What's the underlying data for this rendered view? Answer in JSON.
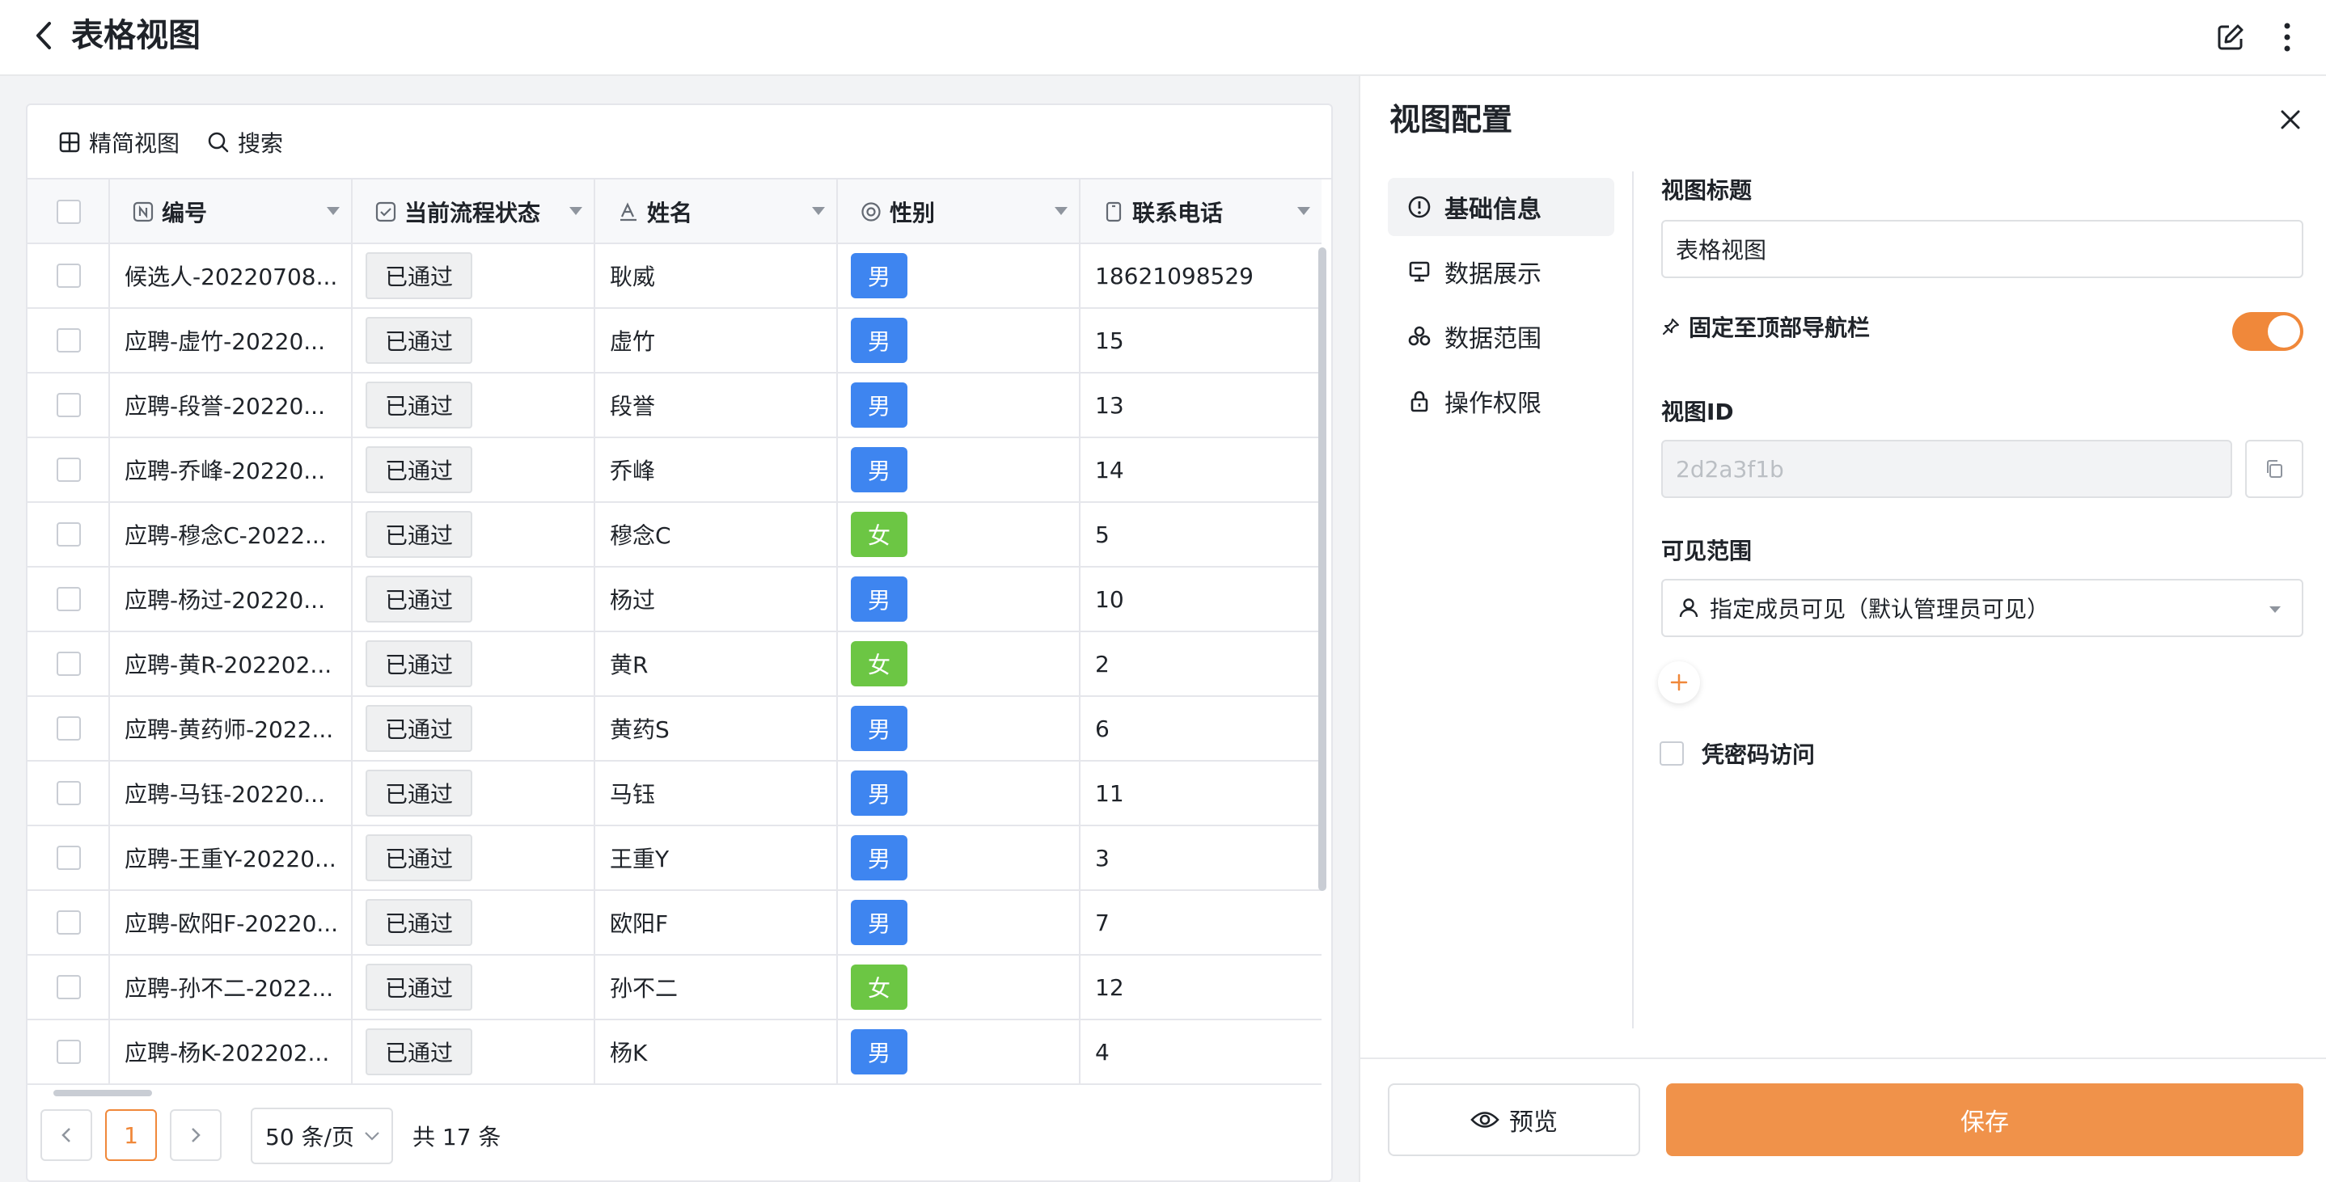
{
  "header": {
    "title": "表格视图",
    "back_icon": "chevron-left-icon",
    "edit_icon": "edit-icon",
    "more_icon": "more-vertical-icon"
  },
  "toolbar": {
    "compact_view": "精简视图",
    "search": "搜索"
  },
  "table": {
    "columns": [
      "编号",
      "当前流程状态",
      "姓名",
      "性别",
      "联系电话"
    ],
    "rows": [
      {
        "id": "候选人-20220708...",
        "status": "已通过",
        "name": "耿威",
        "gender": "男",
        "phone": "18621098529"
      },
      {
        "id": "应聘-虚竹-20220...",
        "status": "已通过",
        "name": "虚竹",
        "gender": "男",
        "phone": "15"
      },
      {
        "id": "应聘-段誉-20220...",
        "status": "已通过",
        "name": "段誉",
        "gender": "男",
        "phone": "13"
      },
      {
        "id": "应聘-乔峰-20220...",
        "status": "已通过",
        "name": "乔峰",
        "gender": "男",
        "phone": "14"
      },
      {
        "id": "应聘-穆念C-2022...",
        "status": "已通过",
        "name": "穆念C",
        "gender": "女",
        "phone": "5"
      },
      {
        "id": "应聘-杨过-20220...",
        "status": "已通过",
        "name": "杨过",
        "gender": "男",
        "phone": "10"
      },
      {
        "id": "应聘-黄R-202202...",
        "status": "已通过",
        "name": "黄R",
        "gender": "女",
        "phone": "2"
      },
      {
        "id": "应聘-黄药师-2022...",
        "status": "已通过",
        "name": "黄药S",
        "gender": "男",
        "phone": "6"
      },
      {
        "id": "应聘-马钰-20220...",
        "status": "已通过",
        "name": "马钰",
        "gender": "男",
        "phone": "11"
      },
      {
        "id": "应聘-王重Y-20220...",
        "status": "已通过",
        "name": "王重Y",
        "gender": "男",
        "phone": "3"
      },
      {
        "id": "应聘-欧阳F-20220...",
        "status": "已通过",
        "name": "欧阳F",
        "gender": "男",
        "phone": "7"
      },
      {
        "id": "应聘-孙不二-2022...",
        "status": "已通过",
        "name": "孙不二",
        "gender": "女",
        "phone": "12"
      },
      {
        "id": "应聘-杨K-202202...",
        "status": "已通过",
        "name": "杨K",
        "gender": "男",
        "phone": "4"
      }
    ]
  },
  "pagination": {
    "current_page": "1",
    "page_size": "50 条/页",
    "total": "共 17 条"
  },
  "panel": {
    "title": "视图配置",
    "nav": [
      "基础信息",
      "数据展示",
      "数据范围",
      "操作权限"
    ],
    "active_nav": "基础信息",
    "view_title_label": "视图标题",
    "view_title_value": "表格视图",
    "pin_label": "固定至顶部导航栏",
    "pin_enabled": true,
    "view_id_label": "视图ID",
    "view_id_value": "2d2a3f1b",
    "visibility_label": "可见范围",
    "visibility_value": "指定成员可见（默认管理员可见）",
    "password_label": "凭密码访问",
    "preview_button": "预览",
    "save_button": "保存"
  },
  "colors": {
    "accent": "#f0883a",
    "male": "#3e85f0",
    "female": "#6cc644",
    "tag_bg": "#eff0f1"
  }
}
